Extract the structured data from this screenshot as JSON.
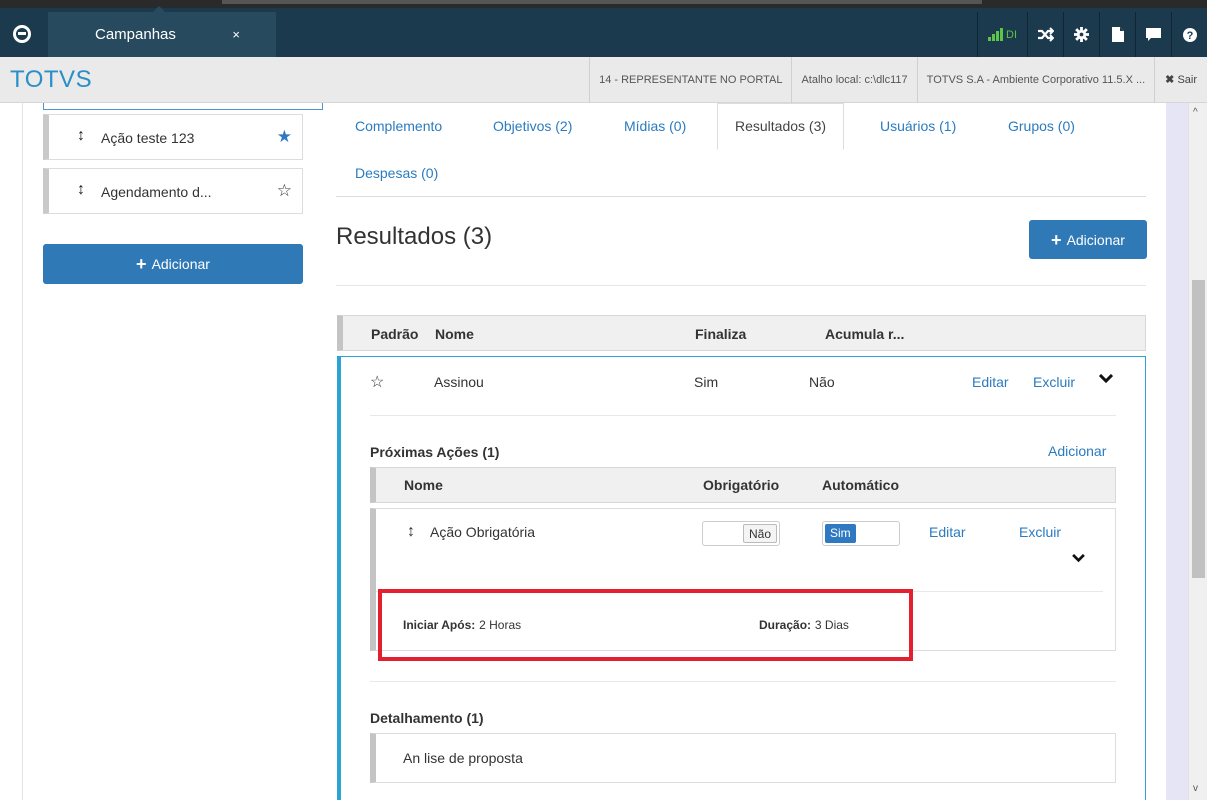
{
  "topbar": {
    "tab_label": "Campanhas",
    "tab_close": "×",
    "signal_text": "DI",
    "icons": [
      "shuffle-icon",
      "gear-icon",
      "document-icon",
      "chat-icon",
      "help-icon"
    ]
  },
  "subheader": {
    "brand": "TOTVS",
    "items": [
      "14 - REPRESENTANTE NO PORTAL",
      "Atalho local: c:\\dlc117",
      "TOTVS S.A - Ambiente Corporativo 11.5.X ..."
    ],
    "sair": "Sair"
  },
  "sidebar": {
    "items": [
      {
        "label": "Ação teste 123",
        "starred": true
      },
      {
        "label": "Agendamento d...",
        "starred": false
      }
    ],
    "add_label": "Adicionar"
  },
  "tabs": [
    {
      "label": "Complemento"
    },
    {
      "label": "Objetivos (2)"
    },
    {
      "label": "Mídias (0)"
    },
    {
      "label": "Resultados (3)",
      "active": true
    },
    {
      "label": "Usuários (1)"
    },
    {
      "label": "Grupos (0)"
    },
    {
      "label": "Despesas (0)"
    }
  ],
  "main": {
    "title": "Resultados (3)",
    "add_label": "Adicionar"
  },
  "results_table": {
    "headers": [
      "Padrão",
      "Nome",
      "Finaliza",
      "Acumula r..."
    ],
    "row": {
      "nome": "Assinou",
      "finaliza": "Sim",
      "acumula": "Não",
      "edit": "Editar",
      "delete": "Excluir"
    }
  },
  "proximas_acoes": {
    "title": "Próximas Ações (1)",
    "add": "Adicionar",
    "headers": [
      "Nome",
      "Obrigatório",
      "Automático"
    ],
    "item": {
      "nome": "Ação Obrigatória",
      "obrigatorio": "Não",
      "automatico": "Sim",
      "edit": "Editar",
      "delete": "Excluir",
      "iniciar_label": "Iniciar Após:",
      "iniciar_value": "2 Horas",
      "duracao_label": "Duração:",
      "duracao_value": "3 Dias"
    }
  },
  "detalhamento": {
    "title": "Detalhamento (1)",
    "item": "An lise de proposta"
  },
  "colors": {
    "topbar": "#1b3a4d",
    "brand": "#2a8fc8",
    "button": "#3079b7",
    "link": "#2a7bbf",
    "panel_accent": "#2ca3d6",
    "highlight": "#e3202f"
  }
}
